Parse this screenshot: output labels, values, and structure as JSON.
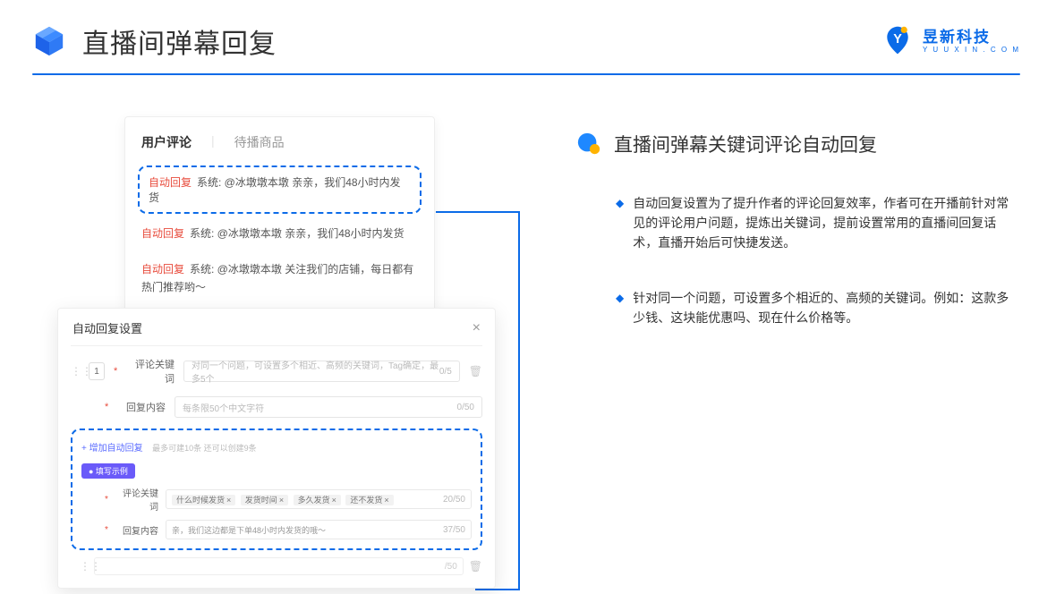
{
  "page_title": "直播间弹幕回复",
  "brand": {
    "cn": "昱新科技",
    "en": "Y U U X I N . C O M"
  },
  "section_title": "直播间弹幕关键词评论自动回复",
  "bullets": [
    "自动回复设置为了提升作者的评论回复效率，作者可在开播前针对常见的评论用户问题，提炼出关键词，提前设置常用的直播间回复话术，直播开始后可快捷发送。",
    "针对同一个问题，可设置多个相近的、高频的关键词。例如：这款多少钱、这块能优惠吗、现在什么价格等。"
  ],
  "tabs": {
    "t1": "用户评论",
    "t2": "待播商品"
  },
  "comments": [
    {
      "tag": "自动回复",
      "text": "系统: @冰墩墩本墩 亲亲，我们48小时内发货"
    },
    {
      "tag": "自动回复",
      "text": "系统: @冰墩墩本墩 亲亲，我们48小时内发货"
    },
    {
      "tag": "自动回复",
      "text": "系统: @冰墩墩本墩 关注我们的店铺，每日都有热门推荐哟～"
    }
  ],
  "settings": {
    "title": "自动回复设置",
    "row_number": "1",
    "label_keyword": "评论关键词",
    "placeholder_keyword": "对同一个问题，可设置多个相近、高频的关键词，Tag确定，最多5个",
    "count_keyword": "0/5",
    "label_content": "回复内容",
    "placeholder_content": "每条限50个中文字符",
    "count_content": "0/50",
    "add_link": "+ 增加自动回复",
    "add_hint": "最多可建10条 还可以创建9条",
    "example_tag": "● 填写示例",
    "ex_label_kw": "评论关键词",
    "ex_chips": [
      "什么时候发货",
      "发货时间",
      "多久发货",
      "还不发货"
    ],
    "ex_kw_count": "20/50",
    "ex_label_content": "回复内容",
    "ex_content_val": "亲，我们这边都是下单48小时内发货的哦～",
    "ex_content_count": "37/50",
    "ghost_count": "/50"
  }
}
